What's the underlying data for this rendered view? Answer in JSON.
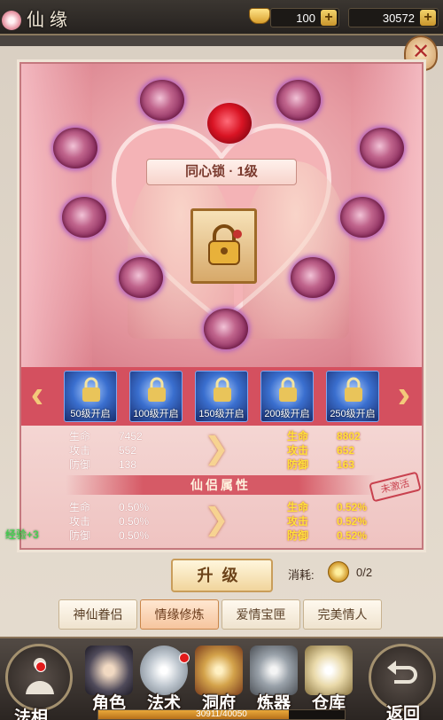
{
  "header": {
    "title": "仙缘",
    "gold_ingots": "100",
    "coins": "30572",
    "close_label": "✕"
  },
  "main": {
    "level_title": "同心锁 · 1级",
    "unlock_slots": [
      {
        "label": "50级开启"
      },
      {
        "label": "100级开启"
      },
      {
        "label": "150级开启"
      },
      {
        "label": "200级开启"
      },
      {
        "label": "250级开启"
      }
    ],
    "stats_current": [
      {
        "name": "生命",
        "value": "7452"
      },
      {
        "name": "攻击",
        "value": "552"
      },
      {
        "name": "防御",
        "value": "138"
      }
    ],
    "stats_next": [
      {
        "name": "生命",
        "value": "8802"
      },
      {
        "name": "攻击",
        "value": "652"
      },
      {
        "name": "防御",
        "value": "163"
      }
    ],
    "companion_title": "仙侣属性",
    "stamp": "未激活",
    "companion_current": [
      {
        "name": "生命",
        "value": "0.50%"
      },
      {
        "name": "攻击",
        "value": "0.50%"
      },
      {
        "name": "防御",
        "value": "0.50%"
      }
    ],
    "companion_next": [
      {
        "name": "生命",
        "value": "0.52%"
      },
      {
        "name": "攻击",
        "value": "0.52%"
      },
      {
        "name": "防御",
        "value": "0.52%"
      }
    ]
  },
  "float_text": "经验+3",
  "upgrade": {
    "label": "升级",
    "cost_label": "消耗:",
    "cost_value": "0/2"
  },
  "tabs": [
    {
      "label": "神仙眷侣",
      "active": false
    },
    {
      "label": "情缘修炼",
      "active": true
    },
    {
      "label": "爱情宝匣",
      "active": false
    },
    {
      "label": "完美情人",
      "active": false
    }
  ],
  "nav": [
    {
      "label": "法相",
      "icon": "buddha-icon"
    },
    {
      "label": "角色",
      "icon": "hero-portrait-icon"
    },
    {
      "label": "法术",
      "icon": "spell-orb-icon"
    },
    {
      "label": "洞府",
      "icon": "cave-mansion-icon"
    },
    {
      "label": "炼器",
      "icon": "forge-hammer-icon"
    },
    {
      "label": "仓库",
      "icon": "treasure-bag-icon"
    },
    {
      "label": "返回",
      "icon": "return-arrow-icon"
    }
  ],
  "exp_bar": {
    "text": "30911/40050",
    "fraction": 0.772
  },
  "colors": {
    "accent_red": "#d4505f",
    "gold": "#f3c97a",
    "stat_highlight": "#ffe23a"
  }
}
